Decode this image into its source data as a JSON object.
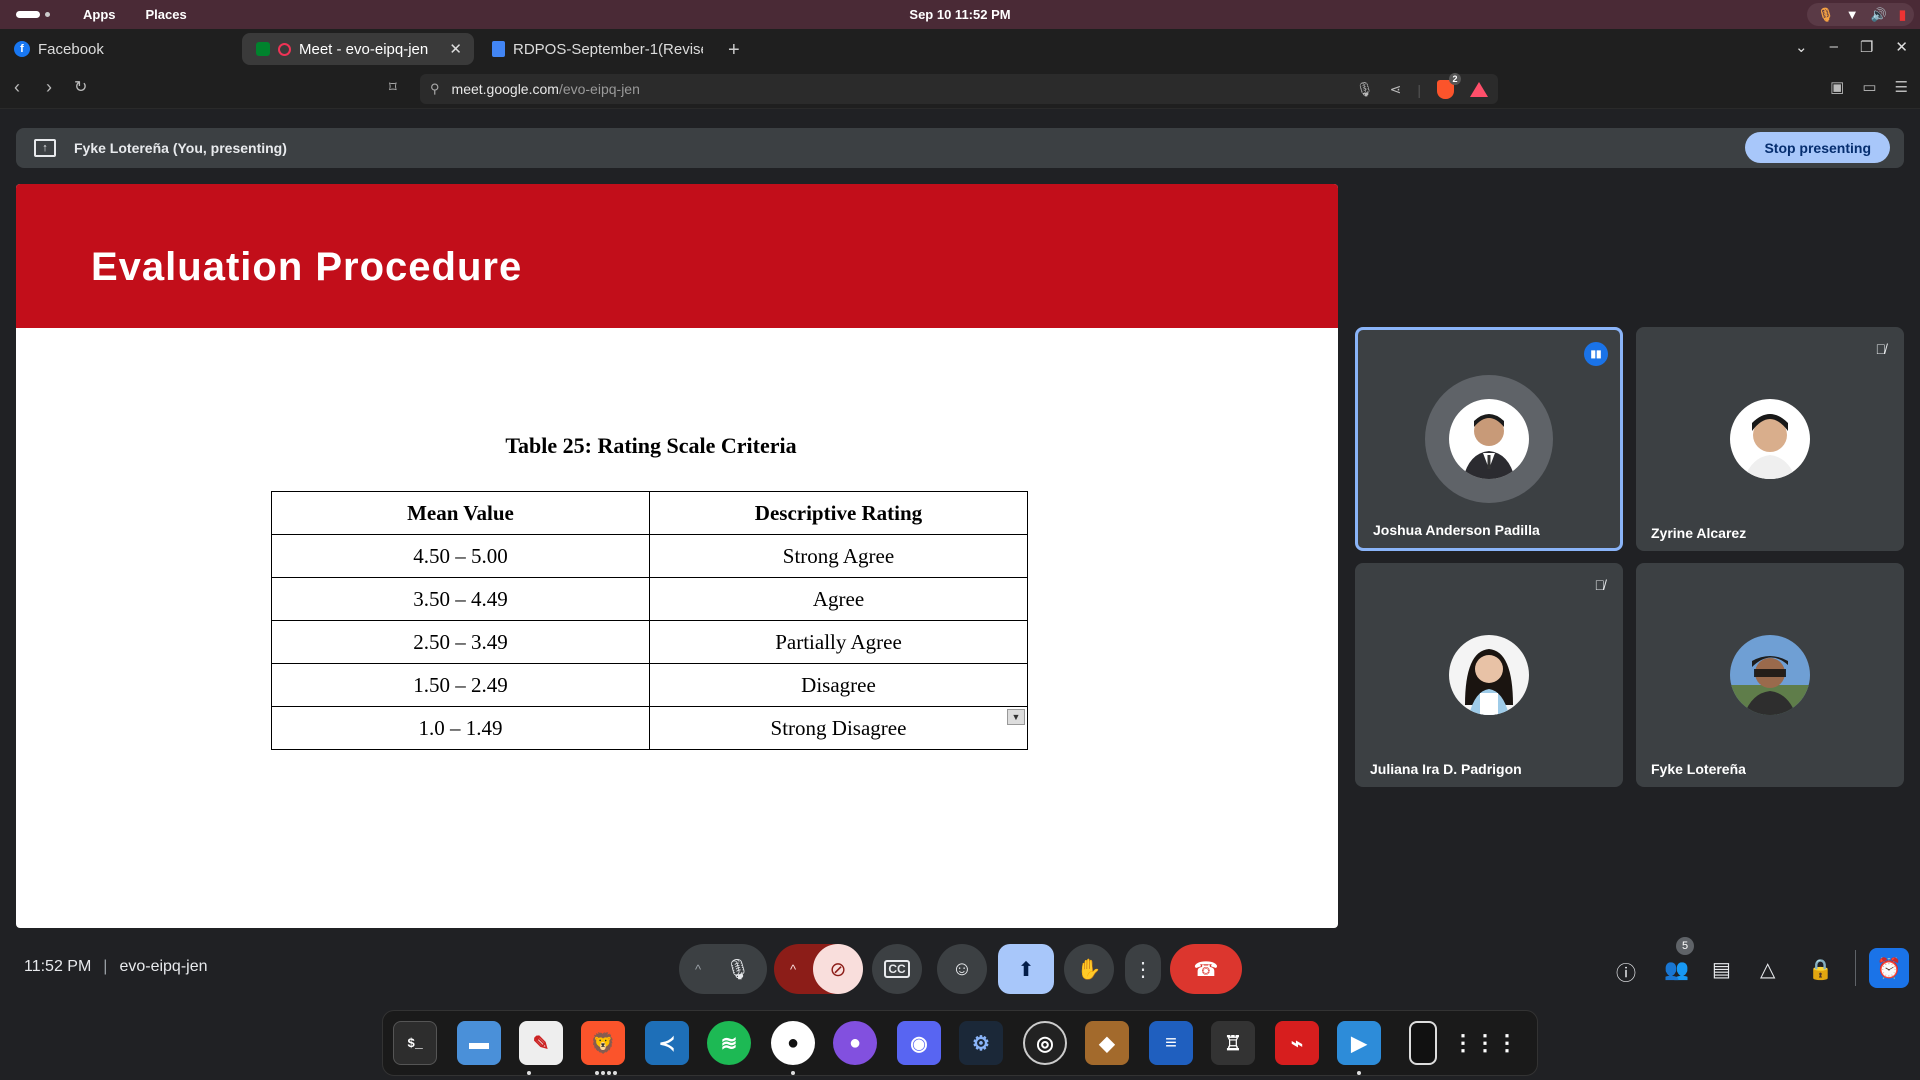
{
  "topbar": {
    "apps": "Apps",
    "places": "Places",
    "clock": "Sep 10  11:52 PM"
  },
  "tabs": [
    {
      "label": "Facebook"
    },
    {
      "label": "Meet - evo-eipq-jen"
    },
    {
      "label": "RDPOS-September-1(Revise"
    }
  ],
  "address": {
    "host": "meet.google.com",
    "path": "/evo-eipq-jen"
  },
  "brave_badge": "2",
  "banner": {
    "who": "Fyke Lotereña (You, presenting)",
    "stop": "Stop presenting"
  },
  "slide": {
    "title": "Evaluation Procedure",
    "caption": "Table 25: Rating Scale Criteria",
    "headers": [
      "Mean Value",
      "Descriptive Rating"
    ],
    "rows": [
      [
        "4.50 – 5.00",
        "Strong Agree"
      ],
      [
        "3.50 – 4.49",
        "Agree"
      ],
      [
        "2.50 – 3.49",
        "Partially Agree"
      ],
      [
        "1.50 – 2.49",
        "Disagree"
      ],
      [
        "1.0 – 1.49",
        "Strong Disagree"
      ]
    ]
  },
  "participants": [
    {
      "name": "Joshua Anderson Padilla"
    },
    {
      "name": "Zyrine Alcarez"
    },
    {
      "name": "Juliana Ira D. Padrigon"
    },
    {
      "name": "Fyke Lotereña"
    }
  ],
  "meeting": {
    "time": "11:52 PM",
    "code": "evo-eipq-jen"
  },
  "people_count": "5",
  "colors": {
    "slide_red": "#c20e1a",
    "speaking_blue": "#8ab4f8",
    "hangup": "#dc362e",
    "stop_button": "#a8c7fa"
  }
}
